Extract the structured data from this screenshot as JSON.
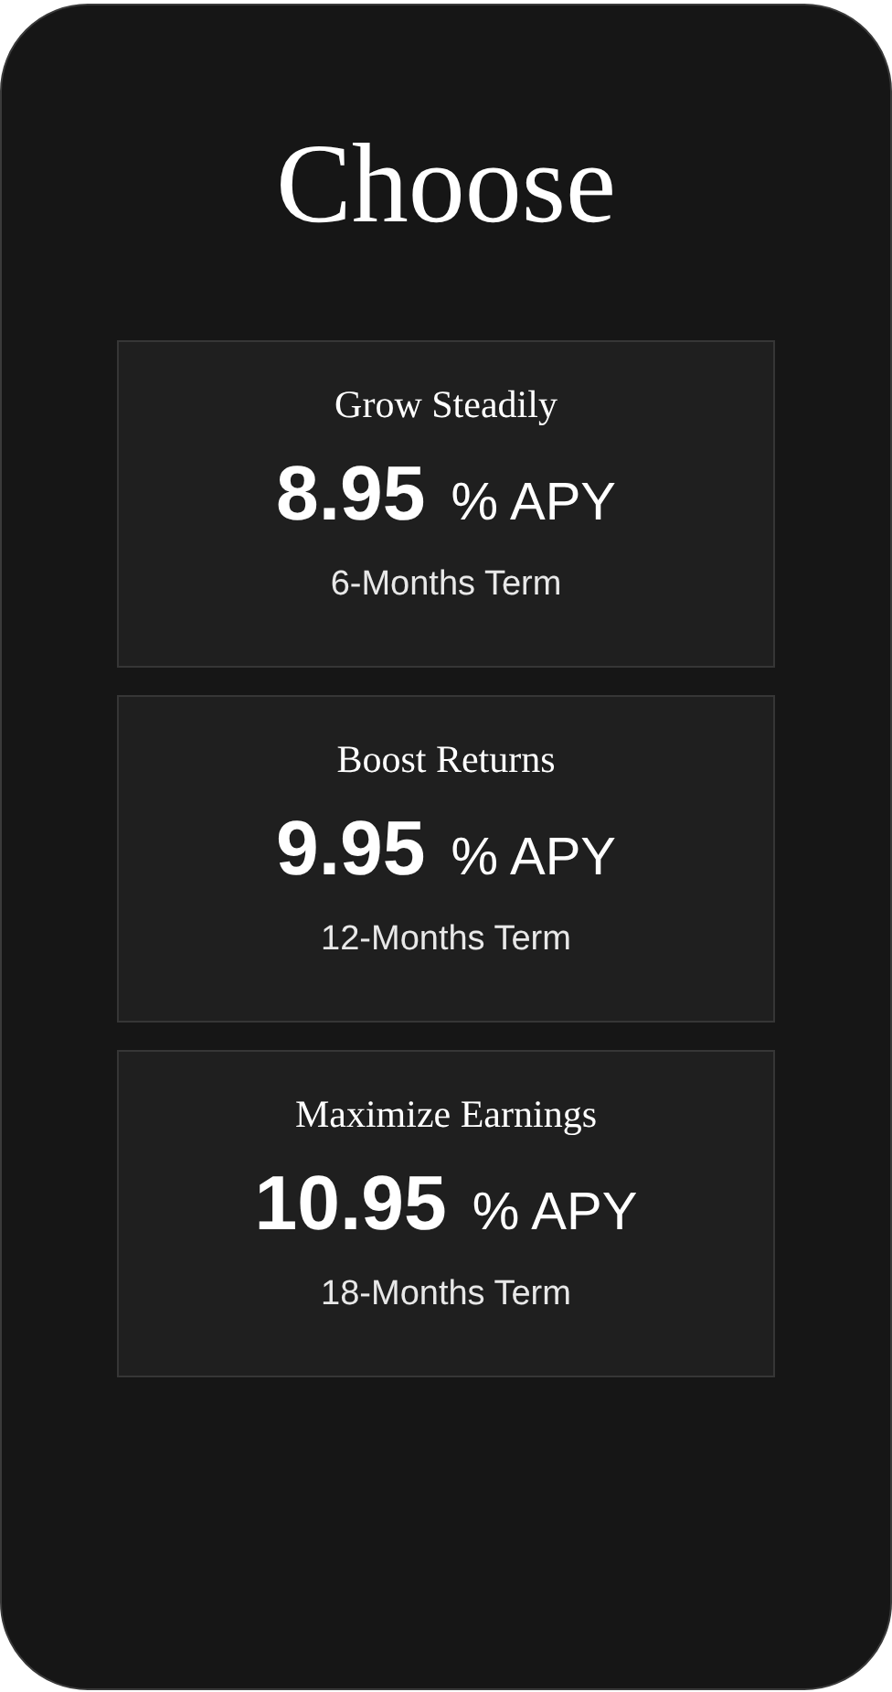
{
  "title": "Choose",
  "plans": [
    {
      "name": "Grow Steadily",
      "rate": "8.95",
      "unit": "% APY",
      "term": "6-Months Term"
    },
    {
      "name": "Boost Returns",
      "rate": "9.95",
      "unit": "% APY",
      "term": "12-Months Term"
    },
    {
      "name": "Maximize Earnings",
      "rate": "10.95",
      "unit": "% APY",
      "term": "18-Months Term"
    }
  ]
}
